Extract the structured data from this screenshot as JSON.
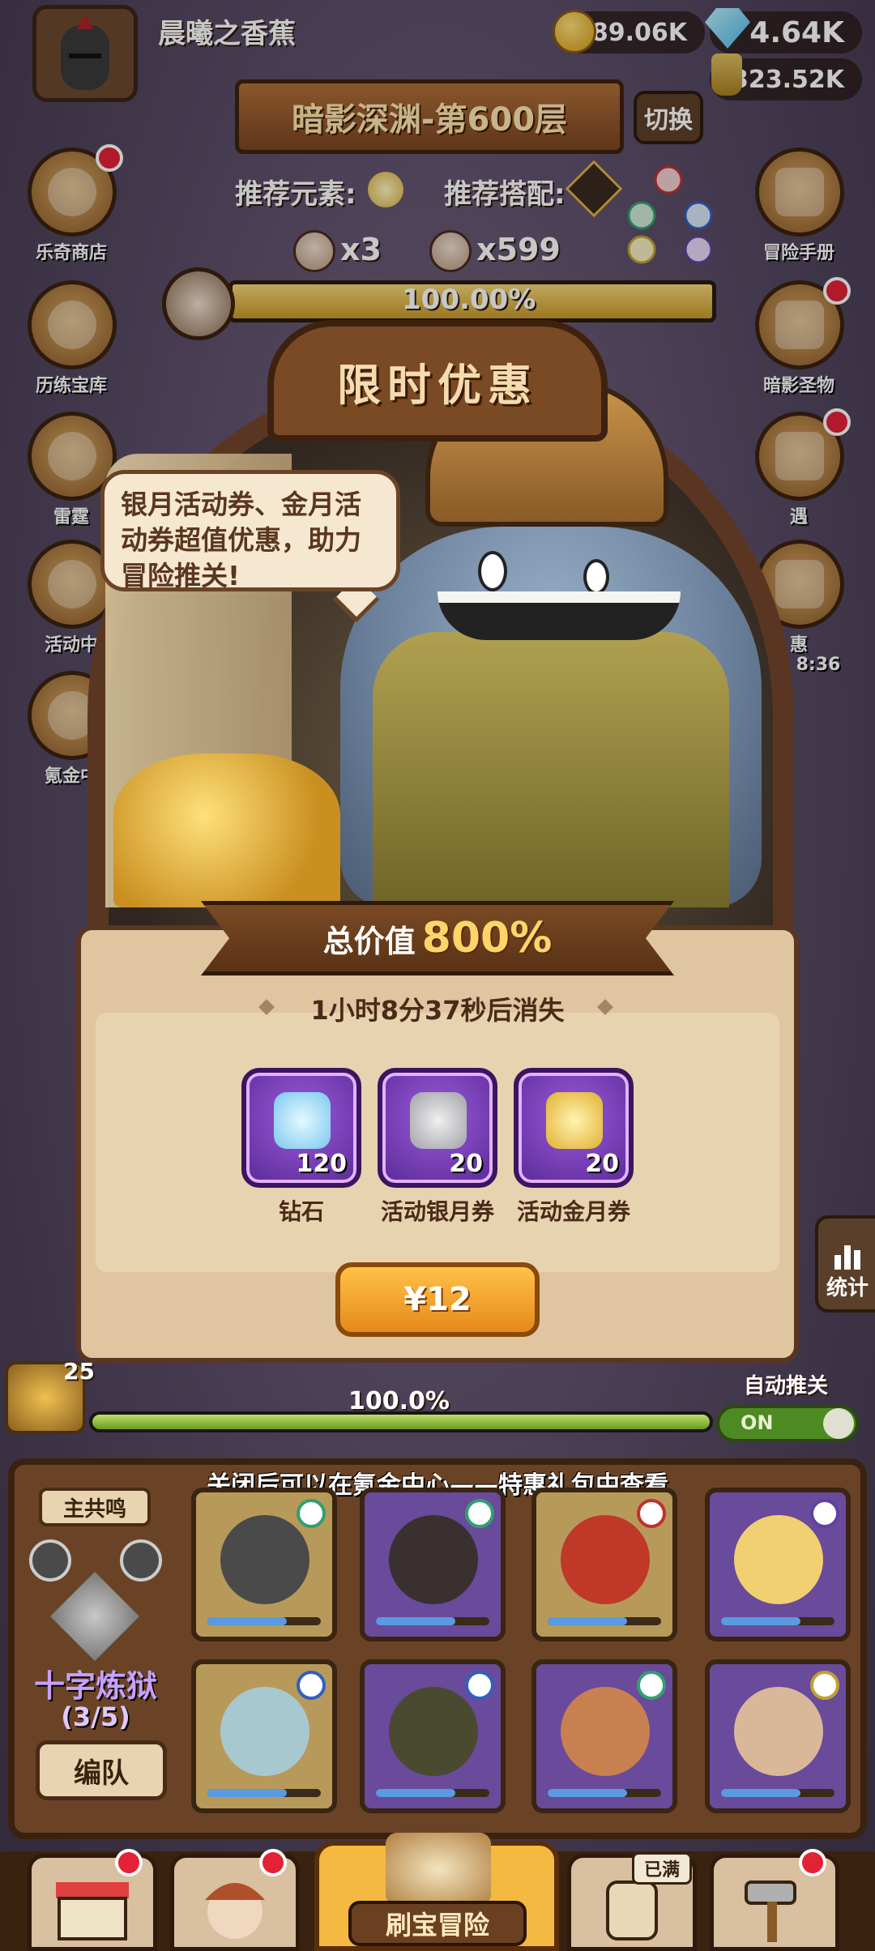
{
  "player": {
    "name": "晨曦之香蕉"
  },
  "resources": {
    "coins": "189.06K",
    "gems": "4.64K",
    "potion": "323.52K"
  },
  "stage": {
    "title": "暗影深渊-第600层",
    "switch_label": "切换",
    "rec_element_label": "推荐元素:",
    "rec_combo_label": "推荐搭配:",
    "skull_small": "x3",
    "skull_big": "x599",
    "progress_text": "100.00%",
    "progress": 1.0
  },
  "left_menu": [
    {
      "label": "乐奇商店",
      "icon": "clover-icon"
    },
    {
      "label": "历练宝库",
      "icon": "treasury-icon"
    },
    {
      "label": "雷霆",
      "icon": "vortex-icon"
    },
    {
      "label": "活动中",
      "icon": "flower-icon"
    },
    {
      "label": "氪金中",
      "icon": "diamond-icon"
    }
  ],
  "right_menu": [
    {
      "label": "冒险手册",
      "icon": "scroll-icon"
    },
    {
      "label": "暗影圣物",
      "icon": "chest-icon"
    },
    {
      "label": "遇",
      "icon": "checklist-icon"
    },
    {
      "label": "惠",
      "sub": "8:36",
      "icon": "purple-chest-icon"
    }
  ],
  "offer": {
    "sign": "限时优惠",
    "bubble": "银月活动券、金月活动券超值优惠，助力冒险推关!",
    "total_value_label": "总价值",
    "total_value": "800%",
    "timer": "1小时8分37秒后消失",
    "items": [
      {
        "label": "钻石",
        "count": "120",
        "icon": "diamond-icon"
      },
      {
        "label": "活动银月券",
        "count": "20",
        "icon": "silver-scroll-icon"
      },
      {
        "label": "活动金月券",
        "count": "20",
        "icon": "gold-scroll-icon"
      }
    ],
    "price": "¥12"
  },
  "stats_label": "统计",
  "auto_push": {
    "label": "自动推关",
    "state": "ON"
  },
  "chest_count": "25",
  "bottom_progress_text": "100.0%",
  "bottom_progress": 1.0,
  "tip": "关闭后可以在氪金中心——特惠礼包中查看",
  "team": {
    "name": "主共鸣",
    "title": "十字炼狱",
    "count": "(3/5)",
    "formation_label": "编队"
  },
  "nav": {
    "center_label": "刷宝冒险",
    "full_badge": "已满"
  }
}
